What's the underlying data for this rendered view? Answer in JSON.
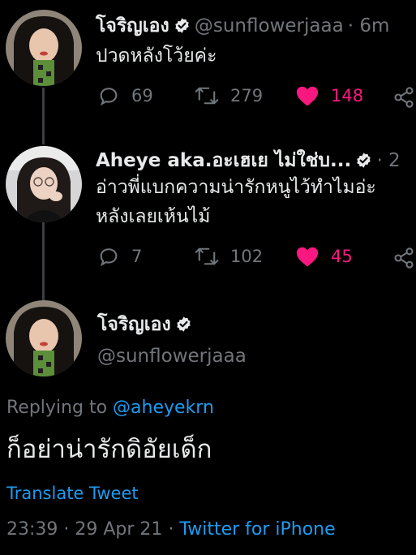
{
  "tweet1": {
    "display_name": "โจริญเอง",
    "handle": "@sunflowerjaaa",
    "time": "· 6m",
    "text": "ปวดหลังโว้ยค่ะ",
    "replies": "69",
    "retweets": "279",
    "likes": "148"
  },
  "tweet2": {
    "display_name": "Aheye aka.อะเฮเย ไม่ใช่บ...",
    "time": "· 2",
    "text_line1": "อ่าวพี่แบกความน่ารักหนูไว้ทำไมอ่ะ",
    "text_line2": "หลังเลยเห้นไม้",
    "replies": "7",
    "retweets": "102",
    "likes": "45"
  },
  "main_tweet": {
    "display_name": "โจริญเอง",
    "handle": "@sunflowerjaaa",
    "replying_prefix": "Replying to",
    "replying_handle": "@aheyekrn",
    "text": "ก็อย่าน่ารักดิอัยเด็ก",
    "translate": "Translate Tweet",
    "time": "23:39",
    "date": "· 29 Apr 21 ·",
    "source": "Twitter for iPhone"
  },
  "colors": {
    "background": "#000000",
    "like": "#f91880",
    "link": "#1d9bf0",
    "muted": "#71767b"
  }
}
